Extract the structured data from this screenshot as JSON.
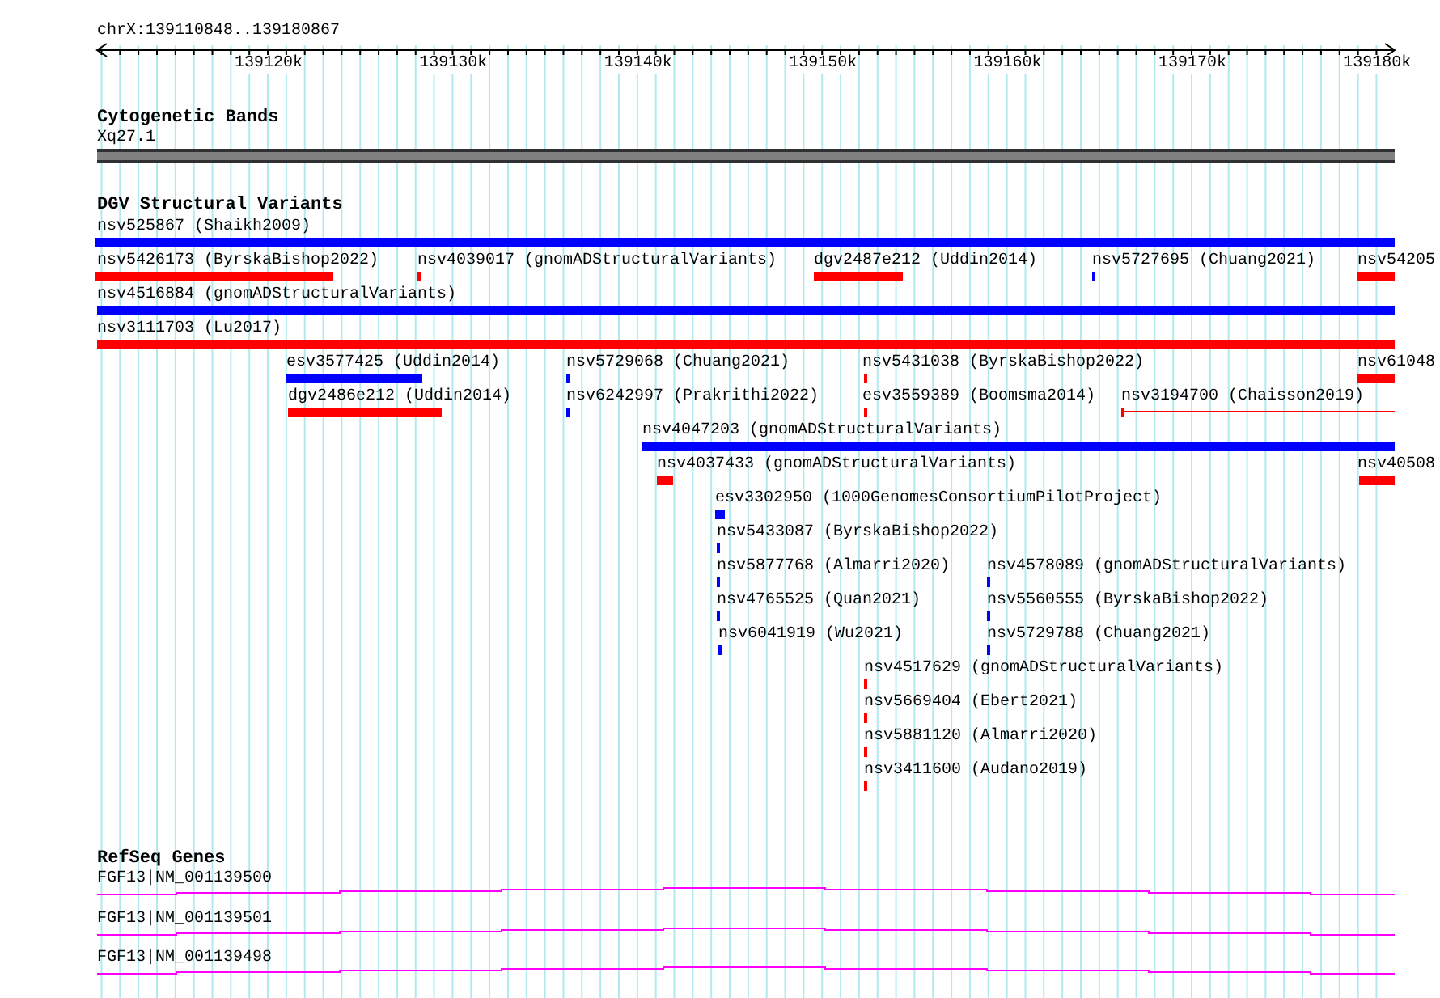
{
  "ruler": {
    "location": "chrX:139110848..139180867",
    "ticks": [
      "139120k",
      "139130k",
      "139140k",
      "139150k",
      "139160k",
      "139170k",
      "139180k"
    ]
  },
  "cytogenetic_bands": {
    "title": "Cytogenetic Bands",
    "band": "Xq27.1"
  },
  "dgv_structural_variants": {
    "title": "DGV Structural Variants",
    "features": [
      {
        "label": "nsv525867 (Shaikh2009)",
        "color": "#0000ff",
        "kind": "bar"
      },
      {
        "label": "nsv5426173 (ByrskaBishop2022)",
        "color": "#ff0000",
        "kind": "bar"
      },
      {
        "label": "nsv4039017 (gnomADStructuralVariants)",
        "color": "#ff0000",
        "kind": "bar"
      },
      {
        "label": "dgv2487e212 (Uddin2014)",
        "color": "#ff0000",
        "kind": "bar"
      },
      {
        "label": "nsv5727695 (Chuang2021)",
        "color": "#0000ff",
        "kind": "bar"
      },
      {
        "label": "nsv54205",
        "color": "#ff0000",
        "kind": "bar"
      },
      {
        "label": "nsv4516884 (gnomADStructuralVariants)",
        "color": "#0000ff",
        "kind": "bar"
      },
      {
        "label": "nsv3111703 (Lu2017)",
        "color": "#ff0000",
        "kind": "bar"
      },
      {
        "label": "esv3577425 (Uddin2014)",
        "color": "#0000ff",
        "kind": "bar"
      },
      {
        "label": "nsv5729068 (Chuang2021)",
        "color": "#0000ff",
        "kind": "bar"
      },
      {
        "label": "nsv5431038 (ByrskaBishop2022)",
        "color": "#ff0000",
        "kind": "bar"
      },
      {
        "label": "nsv61048",
        "color": "#ff0000",
        "kind": "bar"
      },
      {
        "label": "dgv2486e212 (Uddin2014)",
        "color": "#ff0000",
        "kind": "bar"
      },
      {
        "label": "nsv6242997 (Prakrithi2022)",
        "color": "#0000ff",
        "kind": "bar"
      },
      {
        "label": "esv3559389 (Boomsma2014)",
        "color": "#ff0000",
        "kind": "bar"
      },
      {
        "label": "nsv3194700 (Chaisson2019)",
        "color": "#ff0000",
        "kind": "line"
      },
      {
        "label": "nsv4047203 (gnomADStructuralVariants)",
        "color": "#0000ff",
        "kind": "bar"
      },
      {
        "label": "nsv4037433 (gnomADStructuralVariants)",
        "color": "#ff0000",
        "kind": "bar"
      },
      {
        "label": "nsv40508",
        "color": "#ff0000",
        "kind": "bar"
      },
      {
        "label": "esv3302950 (1000GenomesConsortiumPilotProject)",
        "color": "#0000ff",
        "kind": "bar"
      },
      {
        "label": "nsv5433087 (ByrskaBishop2022)",
        "color": "#0000ff",
        "kind": "bar"
      },
      {
        "label": "nsv5877768 (Almarri2020)",
        "color": "#0000ff",
        "kind": "bar"
      },
      {
        "label": "nsv4578089 (gnomADStructuralVariants)",
        "color": "#0000ff",
        "kind": "bar"
      },
      {
        "label": "nsv4765525 (Quan2021)",
        "color": "#0000ff",
        "kind": "bar"
      },
      {
        "label": "nsv5560555 (ByrskaBishop2022)",
        "color": "#0000ff",
        "kind": "bar"
      },
      {
        "label": "nsv6041919 (Wu2021)",
        "color": "#0000ff",
        "kind": "bar"
      },
      {
        "label": "nsv5729788 (Chuang2021)",
        "color": "#0000ff",
        "kind": "bar"
      },
      {
        "label": "nsv4517629 (gnomADStructuralVariants)",
        "color": "#ff0000",
        "kind": "bar"
      },
      {
        "label": "nsv5669404 (Ebert2021)",
        "color": "#ff0000",
        "kind": "bar"
      },
      {
        "label": "nsv5881120 (Almarri2020)",
        "color": "#ff0000",
        "kind": "bar"
      },
      {
        "label": "nsv3411600 (Audano2019)",
        "color": "#ff0000",
        "kind": "bar"
      }
    ]
  },
  "refseq_genes": {
    "title": "RefSeq Genes",
    "genes": [
      "FGF13|NM_001139500",
      "FGF13|NM_001139501",
      "FGF13|NM_001139498"
    ]
  }
}
